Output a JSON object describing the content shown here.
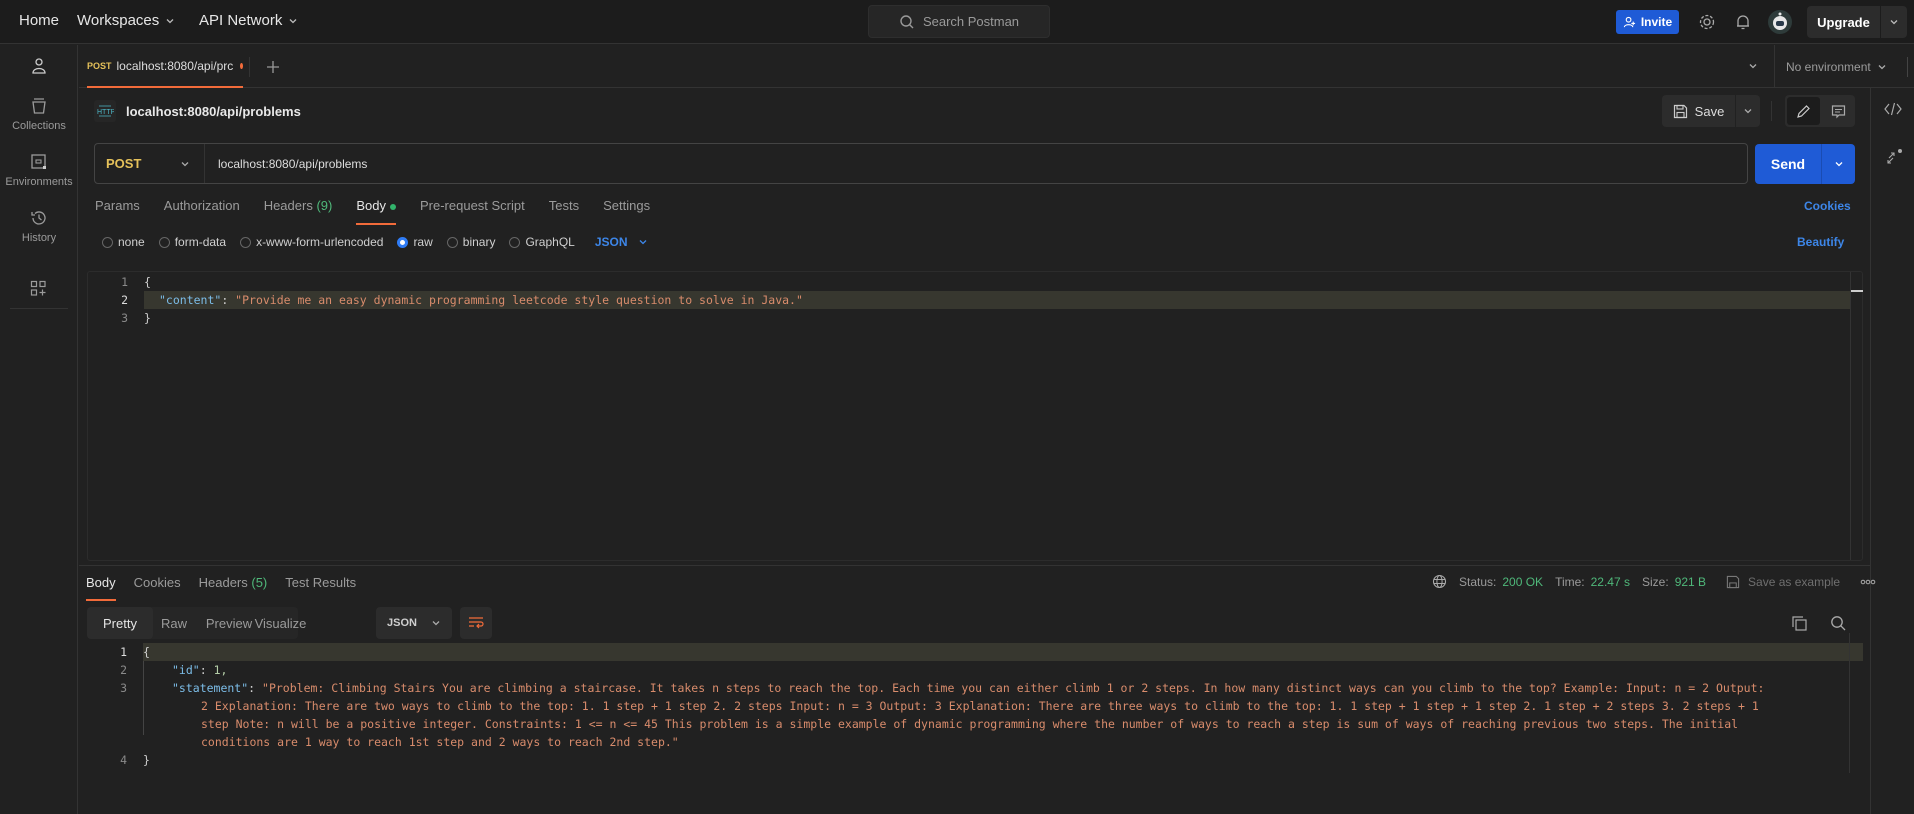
{
  "topbar": {
    "nav": [
      {
        "label": "Home"
      },
      {
        "label": "Workspaces"
      },
      {
        "label": "API Network"
      }
    ],
    "search_placeholder": "Search Postman",
    "invite_label": "Invite",
    "upgrade_label": "Upgrade"
  },
  "sidebar": {
    "items": [
      {
        "label": "Collections",
        "icon": "collections-icon"
      },
      {
        "label": "Environments",
        "icon": "environments-icon"
      },
      {
        "label": "History",
        "icon": "history-icon"
      }
    ]
  },
  "tabs": [
    {
      "method": "POST",
      "title": "localhost:8080/api/prc",
      "unsaved": true
    }
  ],
  "environment": {
    "selected": "No environment"
  },
  "request": {
    "title": "localhost:8080/api/problems",
    "method": "POST",
    "url": "localhost:8080/api/problems",
    "save_label": "Save",
    "send_label": "Send",
    "tabs": [
      {
        "label": "Params"
      },
      {
        "label": "Authorization"
      },
      {
        "label": "Headers",
        "count": "(9)"
      },
      {
        "label": "Body",
        "active": true
      },
      {
        "label": "Pre-request Script"
      },
      {
        "label": "Tests"
      },
      {
        "label": "Settings"
      }
    ],
    "cookies_label": "Cookies",
    "beautify_label": "Beautify",
    "body_types": [
      {
        "label": "none",
        "checked": false
      },
      {
        "label": "form-data",
        "checked": false
      },
      {
        "label": "x-www-form-urlencoded",
        "checked": false
      },
      {
        "label": "raw",
        "checked": true
      },
      {
        "label": "binary",
        "checked": false
      },
      {
        "label": "GraphQL",
        "checked": false
      }
    ],
    "body_language": "JSON",
    "body_lines": [
      {
        "num": "1",
        "text": "{"
      },
      {
        "num": "2",
        "key": "\"content\"",
        "value": "\"Provide me an easy dynamic programming leetcode style question to solve in Java.\""
      },
      {
        "num": "3",
        "text": "}"
      }
    ]
  },
  "response": {
    "tabs": [
      {
        "label": "Body",
        "active": true
      },
      {
        "label": "Cookies"
      },
      {
        "label": "Headers",
        "count": "(5)"
      },
      {
        "label": "Test Results"
      }
    ],
    "status_label": "Status:",
    "status": "200 OK",
    "time_label": "Time:",
    "time": "22.47 s",
    "size_label": "Size:",
    "size": "921 B",
    "save_example_label": "Save as example",
    "view_modes": [
      "Pretty",
      "Raw",
      "Preview",
      "Visualize"
    ],
    "language": "JSON",
    "lines": [
      {
        "num": "1",
        "text": "{"
      },
      {
        "num": "2",
        "key": "\"id\"",
        "value": "1,"
      },
      {
        "num": "3",
        "key": "\"statement\"",
        "value_lines": [
          "\"Problem: Climbing Stairs You are climbing a staircase. It takes n steps to reach the top. Each time you can either climb 1 or 2 steps. In how many distinct ways can you climb to the top? Example: Input: n = 2 Output:",
          "2 Explanation: There are two ways to climb to the top: 1. 1 step + 1 step 2. 2 steps Input: n = 3 Output: 3 Explanation: There are three ways to climb to the top: 1. 1 step + 1 step + 1 step 2. 1 step + 2 steps 3. 2 steps + 1",
          "step Note: n will be a positive integer. Constraints: 1 <= n <= 45 This problem is a simple example of dynamic programming where the number of ways to reach a step is sum of ways of reaching previous two steps. The initial",
          "conditions are 1 way to reach 1st step and 2 ways to reach 2nd step.\""
        ]
      },
      {
        "num": "4",
        "text": "}"
      }
    ]
  },
  "colors": {
    "accent_orange": "#f26b3a",
    "primary_blue": "#1f5bd6",
    "link_blue": "#3d86e8",
    "method_post": "#e5c15a",
    "success_green": "#4fb87a",
    "json_key": "#7cbde8",
    "json_string": "#d98c6c"
  }
}
